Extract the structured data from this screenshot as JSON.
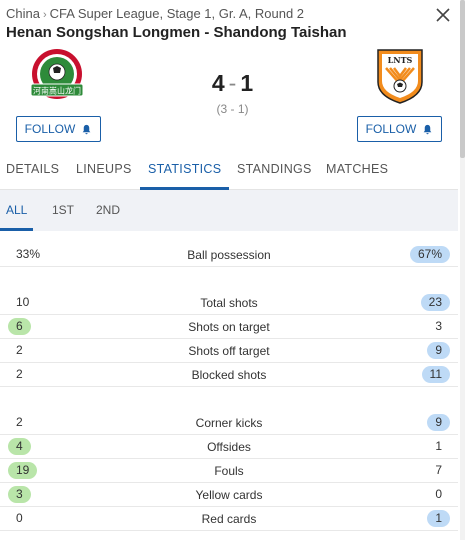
{
  "header": {
    "country": "China",
    "competition": "CFA Super League, Stage 1, Gr. A, Round 2",
    "match_title": "Henan Songshan Longmen - Shandong Taishan"
  },
  "match": {
    "home_goals": "4",
    "away_goals": "1",
    "score_separator": "-",
    "halftime": "(3 - 1)",
    "home_follow_label": "FOLLOW",
    "away_follow_label": "FOLLOW",
    "home_logo_text": "河南嵩山龙门",
    "away_logo_text": "LNTS"
  },
  "tabs": [
    {
      "label": "DETAILS",
      "active": false
    },
    {
      "label": "LINEUPS",
      "active": false
    },
    {
      "label": "STATISTICS",
      "active": true
    },
    {
      "label": "STANDINGS",
      "active": false
    },
    {
      "label": "MATCHES",
      "active": false
    }
  ],
  "subtabs": [
    {
      "label": "ALL",
      "active": true
    },
    {
      "label": "1ST",
      "active": false
    },
    {
      "label": "2ND",
      "active": false
    }
  ],
  "colors": {
    "accent": "#1a5fa8",
    "home_highlight": "#b9e5a9",
    "away_highlight": "#bedaf6"
  },
  "stats": [
    {
      "label": "Ball possession",
      "home": "33%",
      "away": "67%",
      "leader": "away"
    },
    {
      "label": "Total shots",
      "home": "10",
      "away": "23",
      "leader": "away"
    },
    {
      "label": "Shots on target",
      "home": "6",
      "away": "3",
      "leader": "home"
    },
    {
      "label": "Shots off target",
      "home": "2",
      "away": "9",
      "leader": "away"
    },
    {
      "label": "Blocked shots",
      "home": "2",
      "away": "11",
      "leader": "away"
    },
    {
      "label": "Corner kicks",
      "home": "2",
      "away": "9",
      "leader": "away"
    },
    {
      "label": "Offsides",
      "home": "4",
      "away": "1",
      "leader": "home"
    },
    {
      "label": "Fouls",
      "home": "19",
      "away": "7",
      "leader": "home"
    },
    {
      "label": "Yellow cards",
      "home": "3",
      "away": "0",
      "leader": "home"
    },
    {
      "label": "Red cards",
      "home": "0",
      "away": "1",
      "leader": "away"
    }
  ]
}
